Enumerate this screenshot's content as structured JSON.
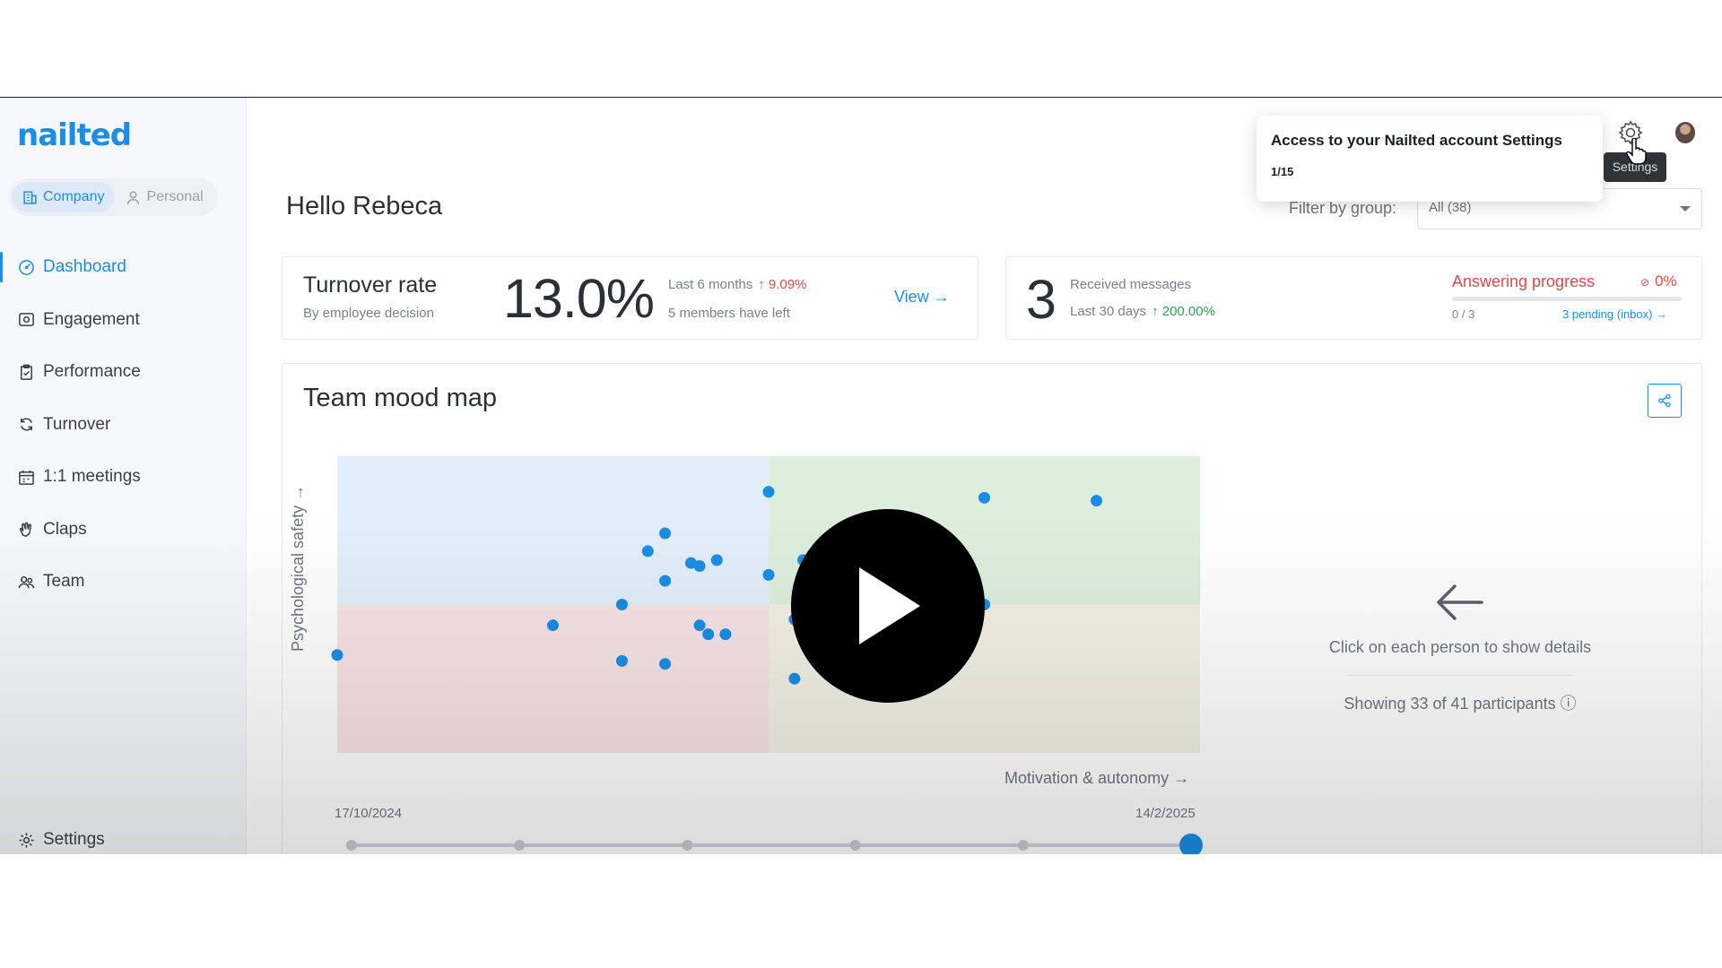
{
  "brand": {
    "logo_text": "nailted",
    "accent": "#1a8ee6"
  },
  "view_toggle": {
    "company_label": "Company",
    "personal_label": "Personal",
    "selected": "Company"
  },
  "sidebar": {
    "items": [
      {
        "label": "Dashboard",
        "icon": "dashboard-icon",
        "active": true
      },
      {
        "label": "Engagement",
        "icon": "engagement-icon"
      },
      {
        "label": "Performance",
        "icon": "performance-icon"
      },
      {
        "label": "Turnover",
        "icon": "refresh-icon"
      },
      {
        "label": "1:1 meetings",
        "icon": "calendar-icon"
      },
      {
        "label": "Claps",
        "icon": "clap-icon"
      },
      {
        "label": "Team",
        "icon": "team-icon"
      }
    ],
    "settings_label": "Settings"
  },
  "header": {
    "greeting": "Hello Rebeca",
    "filter_label": "Filter by group:",
    "filter_value": "All (38)",
    "settings_tooltip": "Settings"
  },
  "onboarding_popover": {
    "title": "Access to your Nailted account Settings",
    "step": "1/15"
  },
  "turnover_card": {
    "title": "Turnover rate",
    "subtitle": "By employee decision",
    "value": "13.0%",
    "period": "Last 6 months",
    "delta": "↑ 9.09%",
    "members_left": "5 members have left",
    "view_label": "View →"
  },
  "messages_card": {
    "count": "3",
    "label": "Received messages",
    "period": "Last 30 days",
    "delta": "↑ 200.00%",
    "progress_title": "Answering progress",
    "progress_pct": "0%",
    "progress_value": 0,
    "answered": "0 / 3",
    "pending_link": "3 pending (inbox) →",
    "alert_color": "#e04848",
    "positive_color": "#2e9e57"
  },
  "mood_map": {
    "title": "Team mood map",
    "y_axis_label": "Psychological safety →",
    "x_axis_label": "Motivation & autonomy →",
    "date_start": "17/10/2024",
    "date_end": "14/2/2025",
    "timeline_selected_index": 5,
    "timeline_stops": 6,
    "detail_hint": "Click on each person to show details",
    "participants_text": "Showing 33 of 41 participants ⓘ",
    "quadrant_colors": {
      "top_left": "#e2effa",
      "top_right": "#dcefdd",
      "bottom_left": "#f7e3e5",
      "bottom_right": "#f2f1e4"
    },
    "point_color": "#1a8ee6"
  },
  "chart_data": {
    "type": "scatter",
    "title": "Team mood map",
    "xlabel": "Motivation & autonomy →",
    "ylabel": "Psychological safety →",
    "xlim": [
      0,
      1
    ],
    "ylim": [
      0,
      1
    ],
    "points": [
      {
        "x": 0.0,
        "y": 0.33
      },
      {
        "x": 0.25,
        "y": 0.43
      },
      {
        "x": 0.33,
        "y": 0.5
      },
      {
        "x": 0.33,
        "y": 0.31
      },
      {
        "x": 0.36,
        "y": 0.68
      },
      {
        "x": 0.38,
        "y": 0.74
      },
      {
        "x": 0.38,
        "y": 0.58
      },
      {
        "x": 0.38,
        "y": 0.3
      },
      {
        "x": 0.41,
        "y": 0.64
      },
      {
        "x": 0.42,
        "y": 0.63
      },
      {
        "x": 0.42,
        "y": 0.43
      },
      {
        "x": 0.43,
        "y": 0.4
      },
      {
        "x": 0.44,
        "y": 0.65
      },
      {
        "x": 0.45,
        "y": 0.4
      },
      {
        "x": 0.5,
        "y": 0.88
      },
      {
        "x": 0.5,
        "y": 0.6
      },
      {
        "x": 0.53,
        "y": 0.45
      },
      {
        "x": 0.53,
        "y": 0.25
      },
      {
        "x": 0.54,
        "y": 0.65
      },
      {
        "x": 0.63,
        "y": 0.46
      },
      {
        "x": 0.7,
        "y": 0.5
      },
      {
        "x": 0.71,
        "y": 0.55
      },
      {
        "x": 0.75,
        "y": 0.86
      },
      {
        "x": 0.75,
        "y": 0.5
      },
      {
        "x": 0.88,
        "y": 0.85
      }
    ]
  }
}
